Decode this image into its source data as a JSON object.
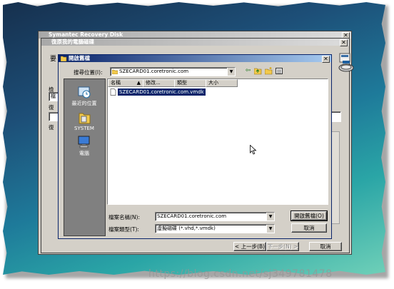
{
  "watermark": "https://blog.csdn.net/sj349781478",
  "back_window": {
    "title": "Symantec Recovery Disk"
  },
  "restore_window": {
    "title": "復原我的電腦磁碟",
    "fragments": [
      "要",
      "檢",
      "檔",
      "復",
      "復"
    ],
    "back_label": "< 上一步(B)",
    "next_label": "下一步(N) >",
    "cancel_label": "取消"
  },
  "open_dialog": {
    "title": "開啟舊檔",
    "lookin_label": "搜尋位置(I):",
    "lookin_value": "SZECARD01.coretronic.com",
    "places": [
      {
        "label": "最近的位置",
        "icon": "recent-places-icon"
      },
      {
        "label": "SYSTEM",
        "icon": "folder-icon"
      },
      {
        "label": "電腦",
        "icon": "computer-icon"
      }
    ],
    "columns": [
      "名稱",
      "修改...",
      "類型",
      "大小"
    ],
    "files": [
      {
        "name": "SZECARD01.coretronic.com.vmdk",
        "selected": true
      }
    ],
    "filename_label": "檔案名稱(N):",
    "filename_value": "SZECARD01.coretronic.com",
    "filetype_label": "檔案類型(T):",
    "filetype_value": "虛擬磁碟 (*.vhd,*.vmdk)",
    "open_label": "開啟舊檔(O)",
    "cancel_label": "取消"
  }
}
